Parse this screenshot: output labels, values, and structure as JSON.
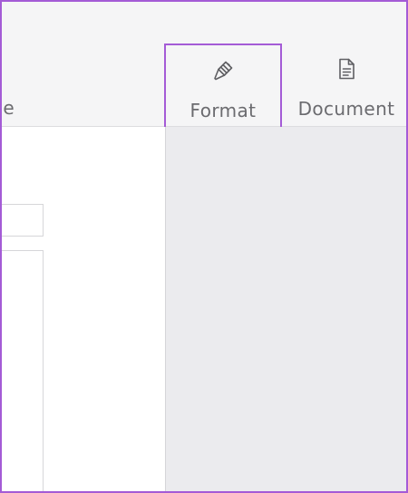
{
  "toolbar": {
    "cut_off_label": "e",
    "buttons": [
      {
        "label": "Format",
        "icon": "paintbrush-icon",
        "state": "highlighted"
      },
      {
        "label": "Document",
        "icon": "document-icon",
        "state": "normal"
      }
    ]
  },
  "colors": {
    "highlight_border": "#a45bd6",
    "toolbar_bg": "#f5f5f6",
    "sidebar_bg": "#ebebee",
    "label_text": "#6b6b6f"
  }
}
